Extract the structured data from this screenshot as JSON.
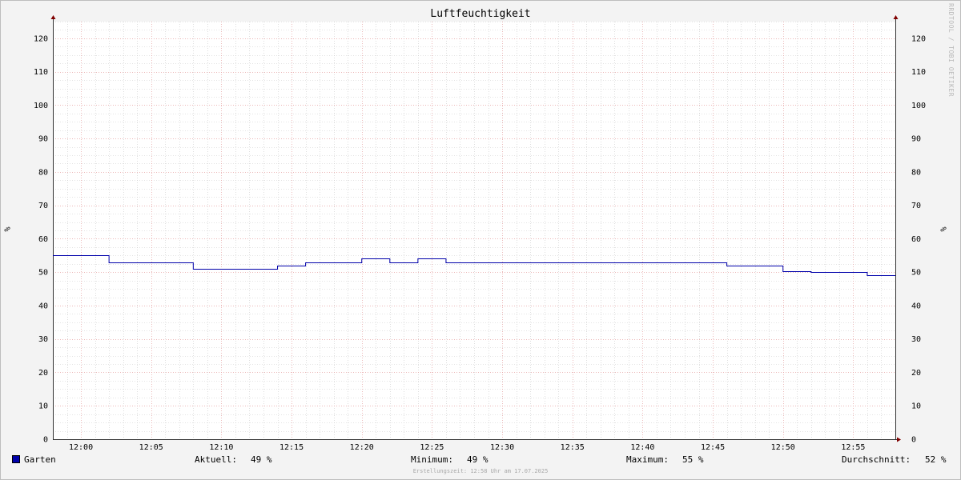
{
  "chart_data": {
    "type": "line",
    "title": "Luftfeuchtigkeit",
    "ylabel": "%",
    "ylabel_right": "%",
    "ylim": [
      0,
      125
    ],
    "yticks": [
      0,
      10,
      20,
      30,
      40,
      50,
      60,
      70,
      80,
      90,
      100,
      110,
      120
    ],
    "xlim_minutes": [
      -2,
      58
    ],
    "xtick_minutes": [
      0,
      5,
      10,
      15,
      20,
      25,
      30,
      35,
      40,
      45,
      50,
      55
    ],
    "xticks": [
      "12:00",
      "12:05",
      "12:10",
      "12:15",
      "12:20",
      "12:25",
      "12:30",
      "12:35",
      "12:40",
      "12:45",
      "12:50",
      "12:55"
    ],
    "grid": true,
    "step": true,
    "series": [
      {
        "name": "Garten",
        "color": "#0000aa",
        "x_minutes": [
          -2,
          2,
          8,
          14,
          16,
          20,
          22,
          24,
          26,
          46,
          50,
          52,
          56,
          58
        ],
        "values": [
          55,
          53,
          51,
          52,
          53,
          54,
          53,
          54,
          53,
          52,
          50.2,
          50,
          49,
          49
        ]
      }
    ]
  },
  "legend": {
    "series_name": "Garten",
    "current_label": "Aktuell:",
    "current_value": "49 %",
    "min_label": "Minimum:",
    "min_value": "49 %",
    "max_label": "Maximum:",
    "max_value": "55 %",
    "avg_label": "Durchschnitt:",
    "avg_value": "52 %"
  },
  "footer": "Erstellungszeit: 12:58 Uhr am 17.07.2025",
  "watermark": "RRDTOOL / TOBI OETIKER",
  "colors": {
    "line": "#0000aa",
    "background": "#f3f3f3",
    "plot_background": "#ffffff",
    "major_grid": "#e6a0a0",
    "minor_grid": "#c8c8c8",
    "axis_arrow": "#800000"
  }
}
